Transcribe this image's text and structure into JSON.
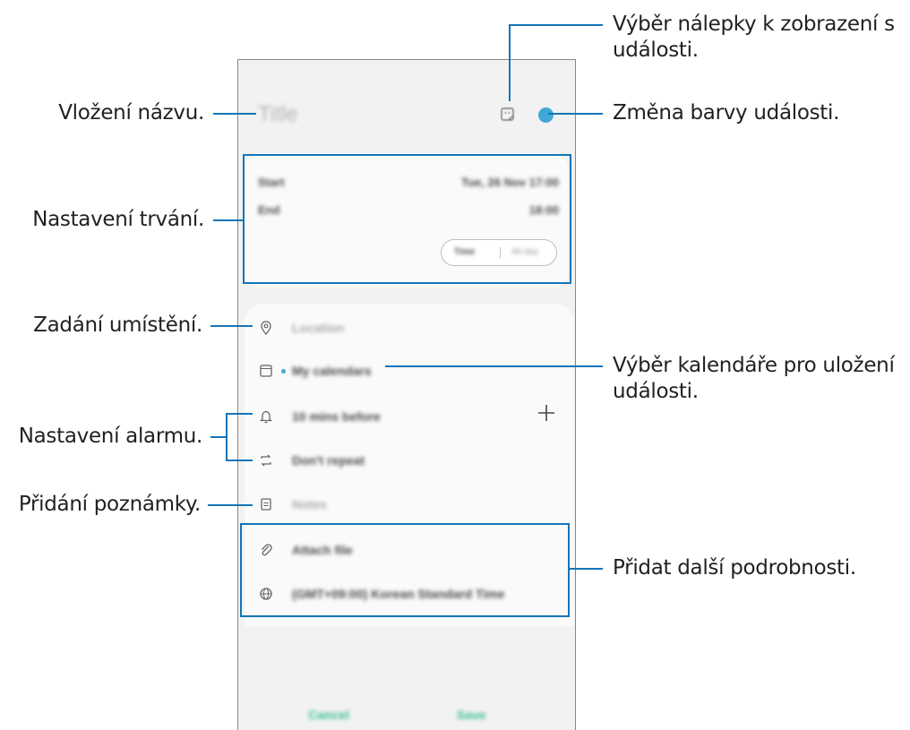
{
  "callouts": {
    "sticker": [
      "Výběr nálepky k zobrazení s",
      "události."
    ],
    "color": "Změna barvy události.",
    "title": "Vložení názvu.",
    "duration": "Nastavení trvání.",
    "location": "Zadání umístění.",
    "calendar": [
      "Výběr kalendáře pro uložení",
      "události."
    ],
    "alarm": "Nastavení alarmu.",
    "note": "Přidání poznámky.",
    "more": "Přidat další podrobnosti."
  },
  "phone": {
    "title_placeholder": "Title",
    "start_label": "Start",
    "start_value": "Tue, 26 Nov  17:00",
    "end_label": "End",
    "end_value": "18:00",
    "segment_left": "Time",
    "segment_right": "All day",
    "location": "Location",
    "calendar": "My calendars",
    "alarm": "10 mins before",
    "repeat": "Don't repeat",
    "notes": "Notes",
    "attach": "Attach file",
    "timezone": "(GMT+09:00) Korean Standard Time",
    "cancel": "Cancel",
    "save": "Save",
    "accent": "#41a8d6",
    "button_color": "#3bbf96"
  }
}
